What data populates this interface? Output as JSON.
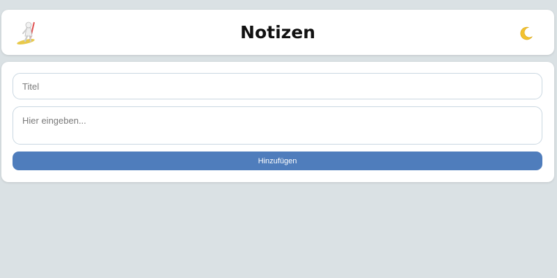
{
  "header": {
    "title": "Notizen",
    "logo_icon": "surfer-logo-icon",
    "theme_toggle_icon": "crescent-moon-icon"
  },
  "form": {
    "title_field": {
      "placeholder": "Titel",
      "value": ""
    },
    "body_field": {
      "placeholder": "Hier eingeben...",
      "value": ""
    },
    "add_button_label": "Hinzufügen"
  },
  "colors": {
    "background": "#dae1e4",
    "surface": "#ffffff",
    "accent": "#4f7dbc",
    "input_border": "#c9d7e1",
    "moon": "#f2c230"
  }
}
